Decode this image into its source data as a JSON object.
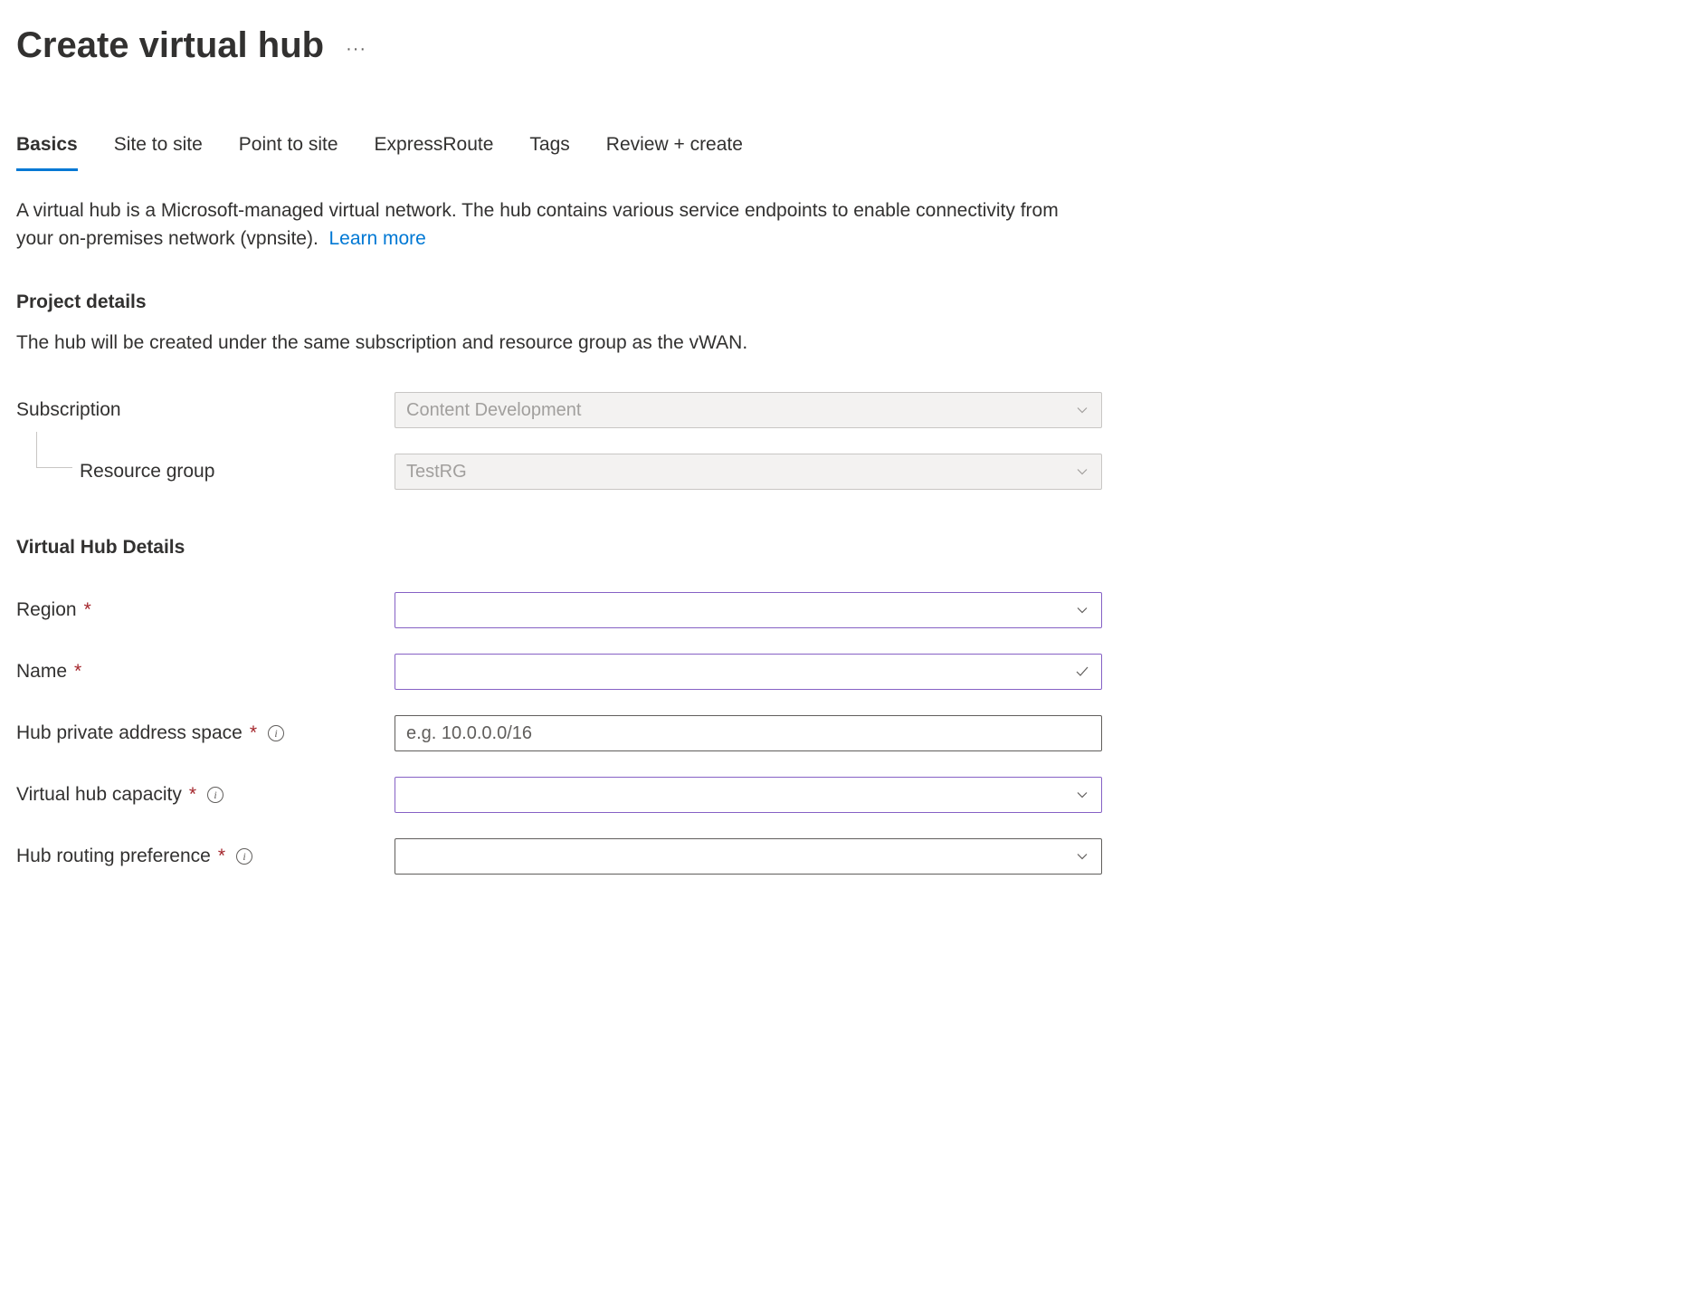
{
  "header": {
    "title": "Create virtual hub"
  },
  "tabs": [
    {
      "label": "Basics",
      "active": true
    },
    {
      "label": "Site to site",
      "active": false
    },
    {
      "label": "Point to site",
      "active": false
    },
    {
      "label": "ExpressRoute",
      "active": false
    },
    {
      "label": "Tags",
      "active": false
    },
    {
      "label": "Review + create",
      "active": false
    }
  ],
  "intro": {
    "text": "A virtual hub is a Microsoft-managed virtual network. The hub contains various service endpoints to enable connectivity from your on-premises network (vpnsite).",
    "learn_more": "Learn more"
  },
  "projectDetails": {
    "heading": "Project details",
    "desc": "The hub will be created under the same subscription and resource group as the vWAN.",
    "subscription_label": "Subscription",
    "subscription_value": "Content Development",
    "resource_group_label": "Resource group",
    "resource_group_value": "TestRG"
  },
  "hubDetails": {
    "heading": "Virtual Hub Details",
    "region_label": "Region",
    "region_value": "",
    "name_label": "Name",
    "name_value": "",
    "addr_label": "Hub private address space",
    "addr_placeholder": "e.g. 10.0.0.0/16",
    "addr_value": "",
    "capacity_label": "Virtual hub capacity",
    "capacity_value": "",
    "routing_label": "Hub routing preference",
    "routing_value": ""
  }
}
